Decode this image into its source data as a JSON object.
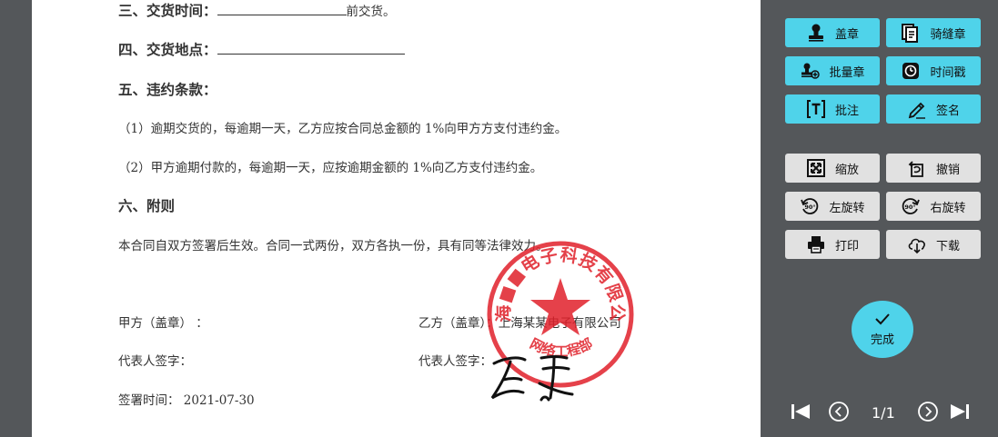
{
  "document": {
    "line1_label": "三、交货时间：",
    "line1_suffix": "前交货。",
    "line2_label": "四、交货地点：",
    "line3_heading": "五、违约条款：",
    "clause1": "（1）逾期交货的，每逾期一天，乙方应按合同总金额的 1%向甲方方支付违约金。",
    "clause2": "（2）甲方逾期付款的，每逾期一天，应按逾期金额的 1%向乙方支付违约金。",
    "appendix_heading": "六、附则",
    "appendix_text": "本合同自双方签署后生效。合同一式两份，双方各执一份，具有同等法律效力。",
    "party_a": "甲方（盖章）  ：",
    "party_b": "乙方（盖章）：上海某某电子有限公司",
    "rep_a": "代表人签字：",
    "rep_b": "代表人签字：",
    "sign_time_label": "签署时间：  2021-07-30"
  },
  "stamp": {
    "top_text": "上海■■电子科技有限公司",
    "bottom_text": "网络工程部",
    "color": "#e0202a"
  },
  "toolbar": {
    "stamp": "盖章",
    "seam_stamp": "骑缝章",
    "batch_stamp": "批量章",
    "timestamp": "时间戳",
    "annotate": "批注",
    "sign": "签名",
    "zoom": "缩放",
    "undo": "撤销",
    "rotate_left": "左旋转",
    "rotate_right": "右旋转",
    "print": "打印",
    "download": "下载",
    "done": "完成"
  },
  "pager": {
    "page": "1/1"
  },
  "colors": {
    "accent": "#4fd3ea",
    "panel_bg": "#54575a",
    "grey_button": "#e1e1e1"
  }
}
